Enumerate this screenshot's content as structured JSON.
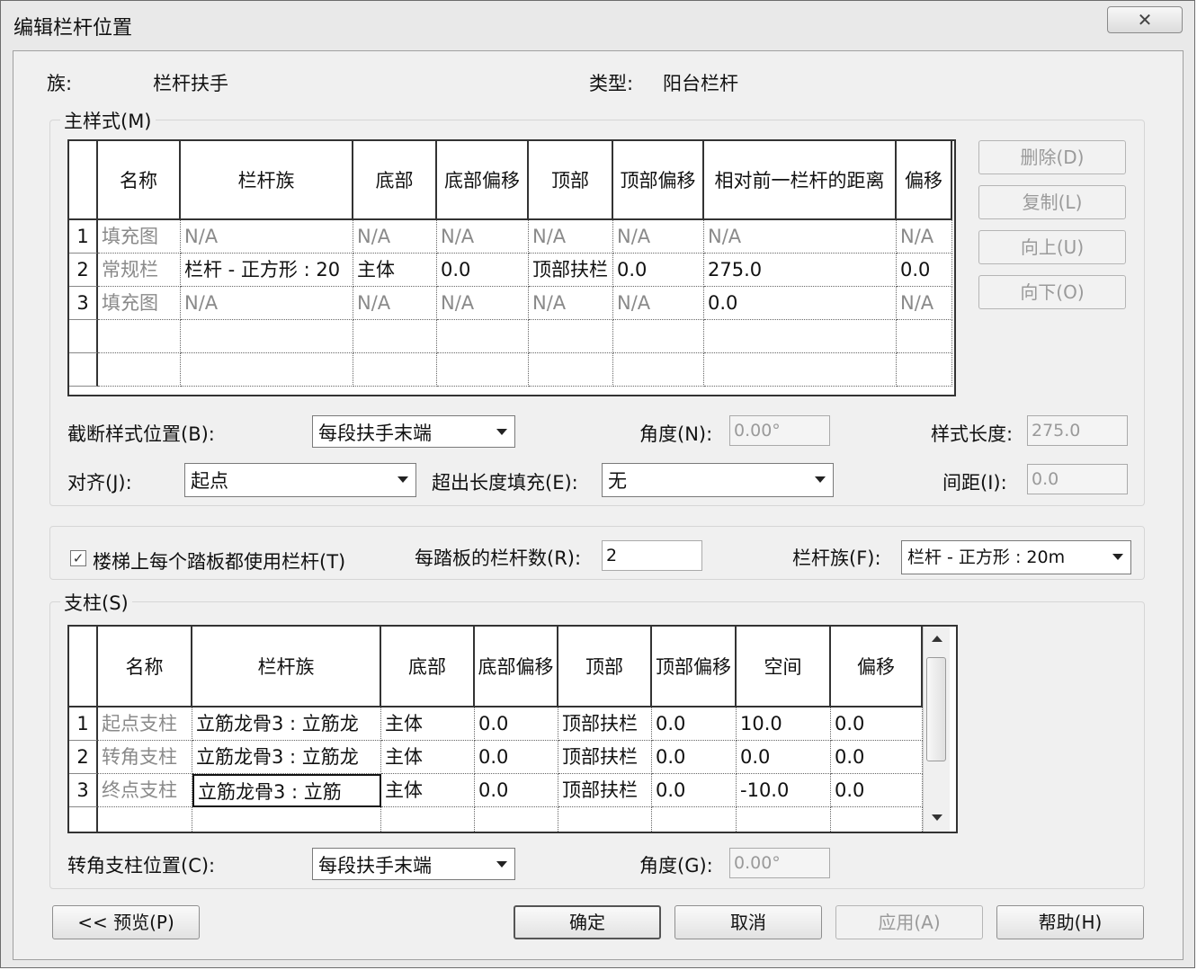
{
  "window": {
    "title": "编辑栏杆位置",
    "close_glyph": "✕"
  },
  "header": {
    "family_label": "族:",
    "family_value": "栏杆扶手",
    "type_label": "类型:",
    "type_value": "阳台栏杆"
  },
  "main_pattern": {
    "group_label": "主样式(M)",
    "columns": [
      "名称",
      "栏杆族",
      "底部",
      "底部偏移",
      "顶部",
      "顶部偏移",
      "相对前一栏杆的距离",
      "偏移"
    ],
    "rows": [
      {
        "num": "1",
        "cells": [
          "填充图",
          "N/A",
          "N/A",
          "N/A",
          "N/A",
          "N/A",
          "N/A",
          "N/A"
        ]
      },
      {
        "num": "2",
        "cells": [
          "常规栏",
          "栏杆 - 正方形 : 20",
          "主体",
          "0.0",
          "顶部扶栏",
          "0.0",
          "275.0",
          "0.0"
        ]
      },
      {
        "num": "3",
        "cells": [
          "填充图",
          "N/A",
          "N/A",
          "N/A",
          "N/A",
          "N/A",
          "0.0",
          "N/A"
        ]
      }
    ],
    "buttons": {
      "delete": "删除(D)",
      "copy": "复制(L)",
      "up": "向上(U)",
      "down": "向下(O)"
    },
    "break_label": "截断样式位置(B):",
    "break_value": "每段扶手末端",
    "angle_label": "角度(N):",
    "angle_value": "0.00°",
    "pattern_length_label": "样式长度:",
    "pattern_length_value": "275.0",
    "justify_label": "对齐(J):",
    "justify_value": "起点",
    "excess_label": "超出长度填充(E):",
    "excess_value": "无",
    "spacing_label": "间距(I):",
    "spacing_value": "0.0"
  },
  "tread": {
    "checkbox_label": "楼梯上每个踏板都使用栏杆(T)",
    "checked": true,
    "per_tread_label": "每踏板的栏杆数(R):",
    "per_tread_value": "2",
    "baluster_family_label": "栏杆族(F):",
    "baluster_family_value": "栏杆 - 正方形 : 20m"
  },
  "posts": {
    "group_label": "支柱(S)",
    "columns": [
      "名称",
      "栏杆族",
      "底部",
      "底部偏移",
      "顶部",
      "顶部偏移",
      "空间",
      "偏移"
    ],
    "rows": [
      {
        "num": "1",
        "cells": [
          "起点支柱",
          "立筋龙骨3 : 立筋龙",
          "主体",
          "0.0",
          "顶部扶栏",
          "0.0",
          "10.0",
          "0.0"
        ]
      },
      {
        "num": "2",
        "cells": [
          "转角支柱",
          "立筋龙骨3 : 立筋龙",
          "主体",
          "0.0",
          "顶部扶栏",
          "0.0",
          "0.0",
          "0.0"
        ]
      },
      {
        "num": "3",
        "cells": [
          "终点支柱",
          "立筋龙骨3 : 立筋",
          "主体",
          "0.0",
          "顶部扶栏",
          "0.0",
          "-10.0",
          "0.0"
        ]
      }
    ],
    "corner_label": "转角支柱位置(C):",
    "corner_value": "每段扶手末端",
    "angle_label": "角度(G):",
    "angle_value": "0.00°"
  },
  "footer": {
    "preview": "<< 预览(P)",
    "ok": "确定",
    "cancel": "取消",
    "apply": "应用(A)",
    "help": "帮助(H)"
  }
}
